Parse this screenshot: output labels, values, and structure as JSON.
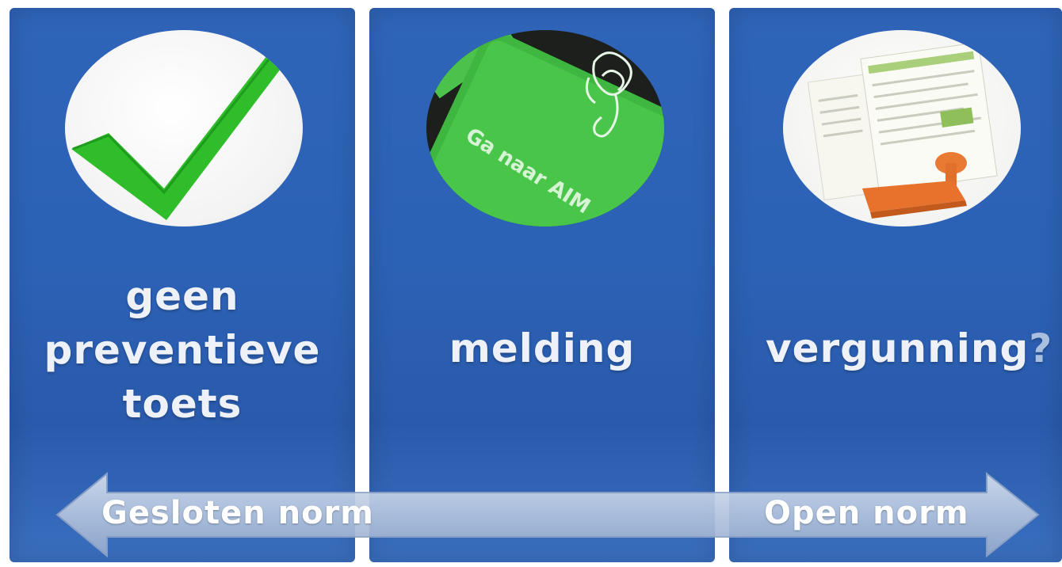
{
  "columns": [
    {
      "label_lines": [
        "geen",
        "preventieve",
        "toets"
      ],
      "icon": "checkmark-icon"
    },
    {
      "label_lines": [
        "melding"
      ],
      "icon": "green-key-icon",
      "key_text": "Ga naar AIM"
    },
    {
      "label_lines": [
        "vergunning"
      ],
      "label_suffix": "?",
      "icon": "permit-stamp-icon"
    }
  ],
  "arrow": {
    "left_label": "Gesloten norm",
    "right_label": "Open norm"
  },
  "colors": {
    "panel": "#2c62b5",
    "check": "#2fbd2a",
    "key": "#3fbf3f",
    "stamp": "#e8722c",
    "arrow": "#b5c6e0"
  }
}
